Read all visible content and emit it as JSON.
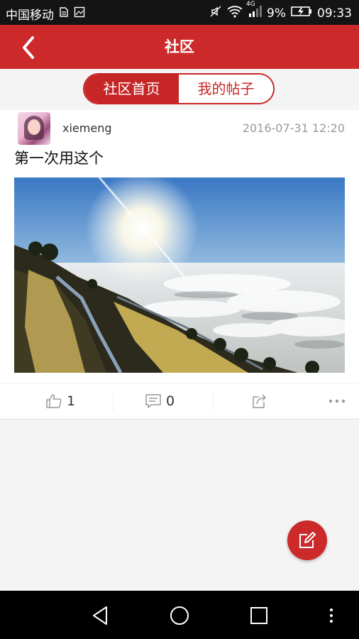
{
  "status_bar": {
    "carrier": "中国移动",
    "battery": "9%",
    "time": "09:33",
    "network": "4G"
  },
  "app_bar": {
    "title": "社区"
  },
  "segment": {
    "tabs": [
      {
        "label": "社区首页",
        "active": true
      },
      {
        "label": "我的帖子",
        "active": false
      }
    ]
  },
  "post": {
    "username": "xiemeng",
    "timestamp": "2016-07-31 12:20",
    "text": "第一次用这个",
    "likes": "1",
    "comments": "0"
  },
  "colors": {
    "brand_red": "#cc2a2a",
    "status_bar": "#141414",
    "background": "#f4f4f4"
  },
  "icons": [
    "back-arrow-icon",
    "thumbs-up-icon",
    "comment-icon",
    "share-icon",
    "more-icon",
    "compose-icon"
  ]
}
